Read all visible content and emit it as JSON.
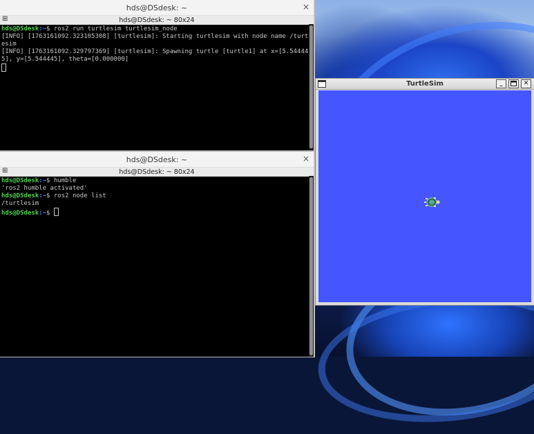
{
  "terminal_top": {
    "title": "hds@DSdesk: ~",
    "tab_label": "hds@DSdesk: ~ 80x24",
    "lines": [
      {
        "type": "prompt",
        "user": "hds@DSdesk",
        "path": ":~",
        "cmd": "$ ros2 run turtlesim turtlesim_node"
      },
      {
        "type": "text",
        "text": "[INFO] [1763161092.323105308] [turtlesim]: Starting turtlesim with node name /turtlesim"
      },
      {
        "type": "text",
        "text": "[INFO] [1763161092.329797369] [turtlesim]: Spawning turtle [turtle1] at x=[5.544445], y=[5.544445], theta=[0.000000]"
      }
    ]
  },
  "terminal_bottom": {
    "title": "hds@DSdesk: ~",
    "tab_label": "hds@DSdesk: ~ 80x24",
    "lines": [
      {
        "type": "prompt",
        "user": "hds@DSdesk",
        "path": ":~",
        "cmd": "$ humble"
      },
      {
        "type": "text",
        "text": "'ros2 humble activated'"
      },
      {
        "type": "prompt",
        "user": "hds@DSdesk",
        "path": ":~",
        "cmd": "$ ros2 node list"
      },
      {
        "type": "text",
        "text": "/turtlesim"
      },
      {
        "type": "prompt",
        "user": "hds@DSdesk",
        "path": ":~",
        "cmd": "$ "
      }
    ]
  },
  "turtlesim": {
    "title": "TurtleSim",
    "background_color": "#4556ff",
    "minimize_label": "_",
    "close_label": "✕"
  },
  "close_glyph": "×",
  "newtab_glyph": "⊞",
  "colors": {
    "prompt_user": "#4fd04f",
    "prompt_path": "#5c8cff",
    "terminal_text": "#c8c8c8"
  }
}
